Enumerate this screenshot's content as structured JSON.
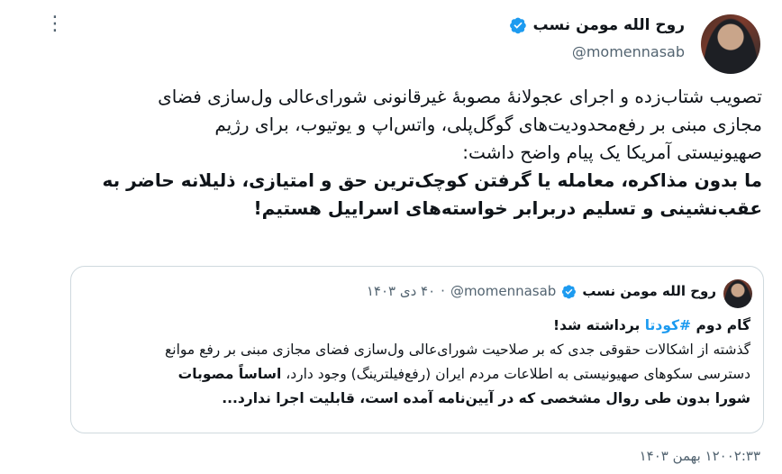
{
  "author": {
    "name": "روح الله مومن نسب",
    "handle": "@momennasab"
  },
  "more_icon": "⋮",
  "post": {
    "line1": "تصویب شتاب‌زده و اجرای عجولانۀ مصوبۀ غیرقانونی شورای‌عالی ول‌سازی فضای",
    "line2": "مجازی مبنی بر رفع‌محدودیت‌های گوگل‌پلی، واتس‌اپ و یوتیوب، برای رژیم",
    "line3": "صهیونیستی آمریکا یک پیام واضح داشت:",
    "line4": "ما بدون مذاکره، معامله یا گرفتن کوچک‌ترین حق و امتیازی، ذلیلانه حاضر به",
    "line5": "عقب‌نشینی و تسلیم دربرابر خواسته‌های اسراییل هستیم!"
  },
  "quote": {
    "name": "روح الله مومن نسب",
    "handle": "@momennasab",
    "separator": "·",
    "date": "۴۰ دی ۱۴۰۳",
    "headline_pre": "گام دوم ",
    "hashtag": "#کودتا",
    "headline_post": " برداشته شد!",
    "line1": "گذشته از اشکالات حقوقی جدی که بر صلاحیت شورای‌عالی ول‌سازی فضای مجازی مبنی بر رفع موانع",
    "line2_normal": "دسترسی سکوهای صهیونیستی به اطلاعات مردم ایران (رفع‌فیلترینگ) وجود دارد، ",
    "line2_bold": "اساساً مصوبات",
    "line3": "شورا بدون طی روال مشخصی که در آیین‌نامه آمده است، قابلیت اجرا ندارد..."
  },
  "timestamp": "۱۲۰۰۲:۳۳ بهمن ۱۴۰۳",
  "colors": {
    "verified": "#1d9bf0",
    "text": "#0f1419",
    "secondary": "#536471",
    "border": "#cfd9de"
  }
}
